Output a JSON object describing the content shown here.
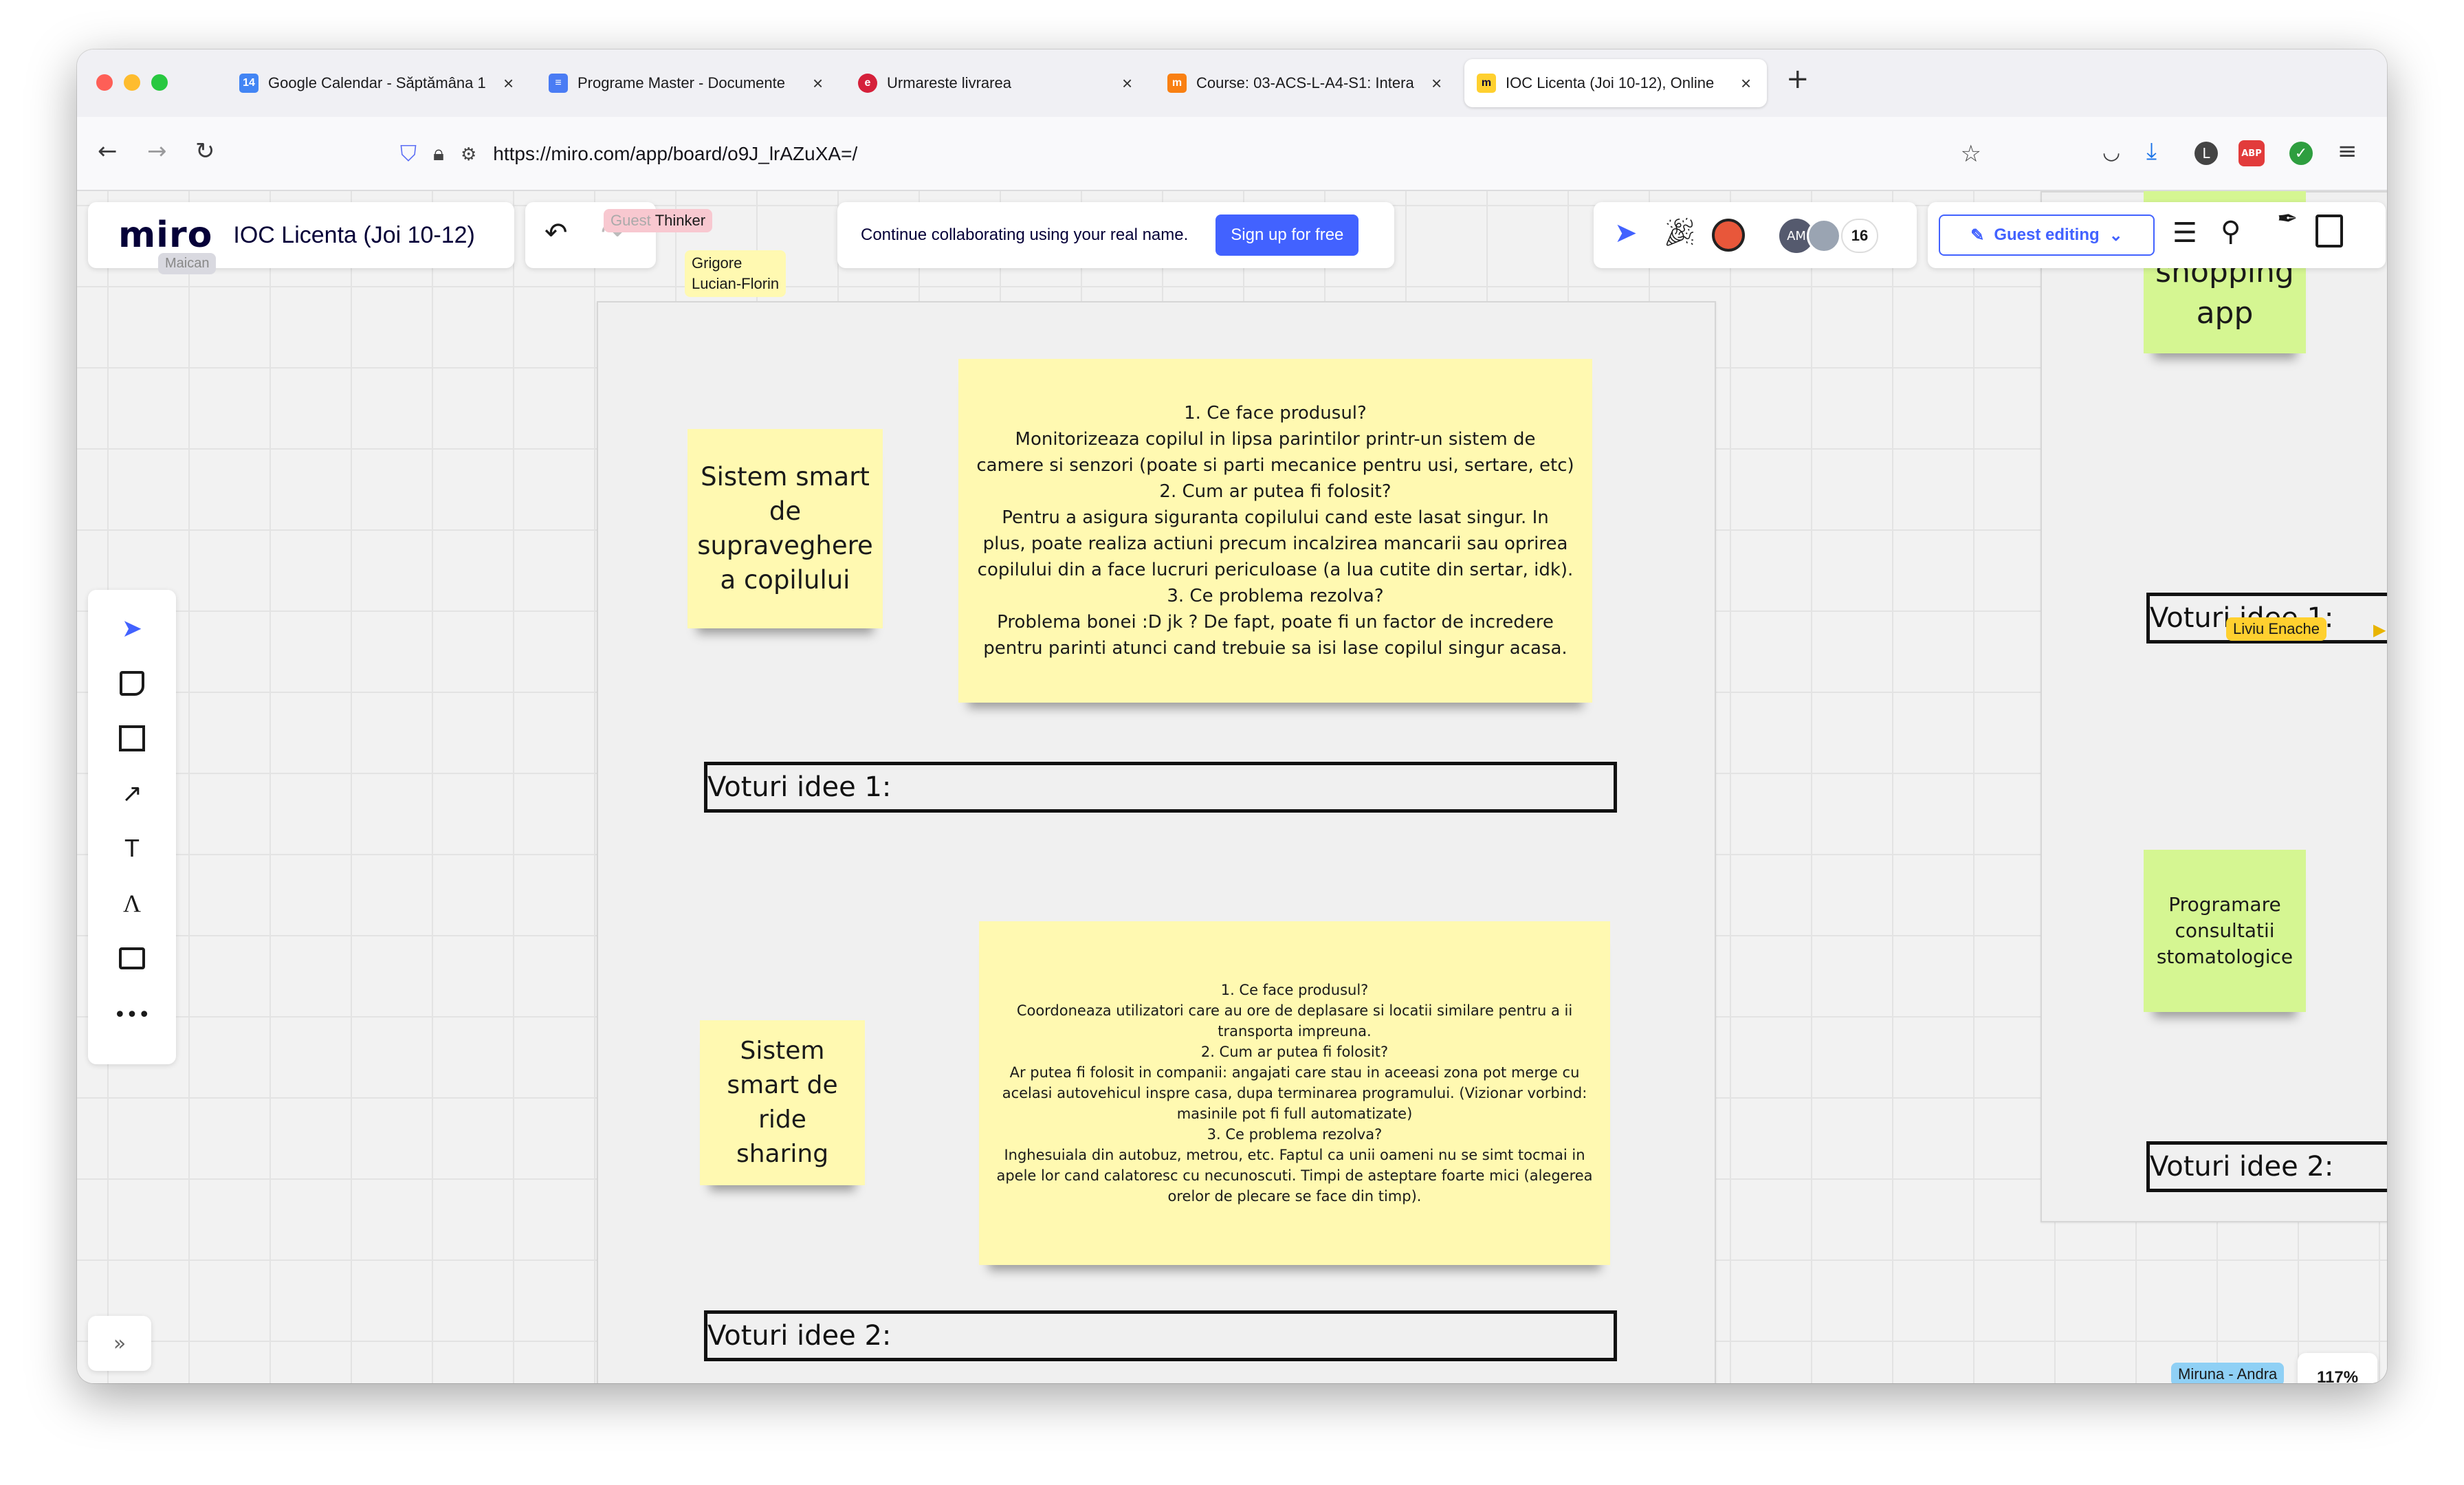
{
  "browser": {
    "tabs": [
      {
        "title": "Google Calendar - Săptămâna 1",
        "favicon": "calendar-icon",
        "favicon_text": "14",
        "color": "#4285f4"
      },
      {
        "title": "Programe Master - Documente",
        "favicon": "docs-icon",
        "favicon_text": "≡",
        "color": "#4a7cf4"
      },
      {
        "title": "Urmareste livrarea",
        "favicon": "emag-icon",
        "favicon_text": "e",
        "color": "#d5203a"
      },
      {
        "title": "Course: 03-ACS-L-A4-S1: Intera",
        "favicon": "moodle-icon",
        "favicon_text": "m",
        "color": "#f98012"
      },
      {
        "title": "IOC Licenta (Joi 10-12), Online",
        "favicon": "miro-icon",
        "favicon_text": "m",
        "color": "#ffd02f",
        "active": true
      }
    ],
    "new_tab_label": "+",
    "url": "https://miro.com/app/board/o9J_lrAZuXA=/"
  },
  "miro": {
    "logo": "miro",
    "board_title": "IOC Licenta (Joi 10-12)",
    "banner_text": "Continue collaborating using your real name.",
    "signup_label": "Sign up for free",
    "guest_editing_label": "Guest editing",
    "collaborator_initials": "AM",
    "collaborator_count": "16",
    "zoom": "117%",
    "guest_label": "Guest",
    "guest_name": "Thinker",
    "cursors": {
      "grigore": "Grigore\nLucian-Florin",
      "maican": "Maican",
      "liviu": "Liviu Enache",
      "miruna": "Miruna - Andra"
    }
  },
  "stickies": {
    "idea1_title": "Sistem smart\nde\nsupraveghere\na copilului",
    "idea1_body": "1. Ce face produsul?\nMonitorizeaza copilul in lipsa parintilor printr-un sistem de\ncamere si senzori (poate si parti mecanice pentru usi, sertare, etc)\n2. Cum ar putea fi folosit?\nPentru a asigura siguranta copilului cand este lasat singur. In\nplus, poate realiza actiuni precum incalzirea mancarii sau oprirea\ncopilului din a face lucruri periculoase (a lua cutite din sertar, idk).\n3. Ce problema rezolva?\nProblema bonei :D jk ? De fapt, poate fi un factor de incredere\npentru parinti atunci cand trebuie sa isi lase copilul singur acasa.",
    "idea2_title": "Sistem\nsmart de\nride\nsharing",
    "idea2_body": "1. Ce face produsul?\nCoordoneaza utilizatori care au ore de deplasare si locatii similare pentru a ii\ntransporta impreuna.\n2. Cum ar putea fi folosit?\nAr putea fi folosit in companii: angajati care stau in aceeasi zona pot merge cu\nacelasi autovehicul inspre casa, dupa terminarea programului. (Vizionar vorbind:\nmasinile pot fi full automatizate)\n3. Ce problema rezolva?\nInghesuiala din autobuz, metrou, etc. Faptul ca unii oameni nu se simt tocmai in\napele lor cand calatoresc cu necunoscuti. Timpi de asteptare foarte mici (alegerea\norelor de plecare se face din timp).",
    "right1": "Online\nshopping\napp",
    "right2": "Programare\nconsultatii\nstomatologice"
  },
  "votes": {
    "idea1": "Voturi idee 1:",
    "idea2": "Voturi idee 2:"
  }
}
